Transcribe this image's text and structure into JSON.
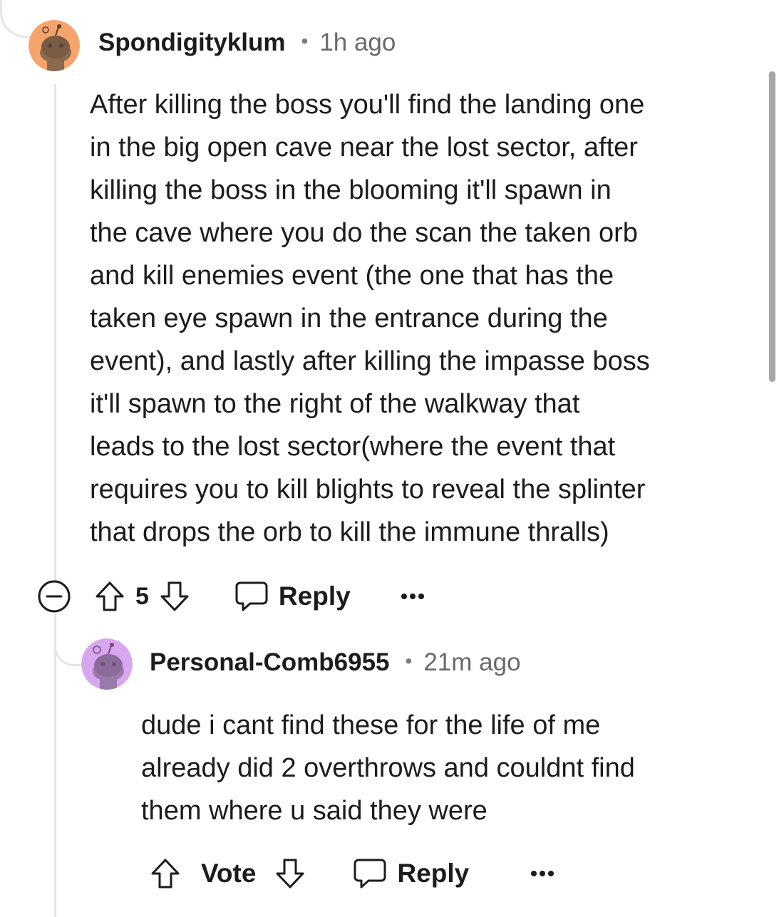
{
  "comment": {
    "username": "Spondigityklum",
    "time": "1h ago",
    "body": "After killing the boss you'll find the landing one\nin the big open cave near the lost sector, after\nkilling the boss in the blooming it'll spawn in\nthe cave where you do the scan the taken orb\nand kill enemies event (the one that has the\ntaken eye spawn in the entrance during the\nevent), and lastly after killing the impasse boss\nit'll spawn to the right of the walkway that\nleads to the lost sector(where the event that\nrequires you to kill blights to reveal the splinter\nthat drops the orb to kill the immune thralls)",
    "score": "5",
    "reply_label": "Reply",
    "avatar_color": "#f5a56b",
    "icons": [
      "collapse-icon",
      "upvote-icon",
      "downvote-icon",
      "reply-icon",
      "more-options-icon"
    ]
  },
  "reply": {
    "username": "Personal-Comb6955",
    "time": "21m ago",
    "body": "dude i cant find these for the life of me\nalready did 2 overthrows and couldnt find\nthem where u said they were",
    "vote_label": "Vote",
    "reply_label": "Reply",
    "avatar_color": "#d9a6f0",
    "icons": [
      "upvote-icon",
      "downvote-icon",
      "reply-icon",
      "more-options-icon"
    ]
  },
  "colors": {
    "text": "#1c1c1c",
    "meta": "#6a6a6a",
    "thread_line": "#e5e5e5"
  }
}
